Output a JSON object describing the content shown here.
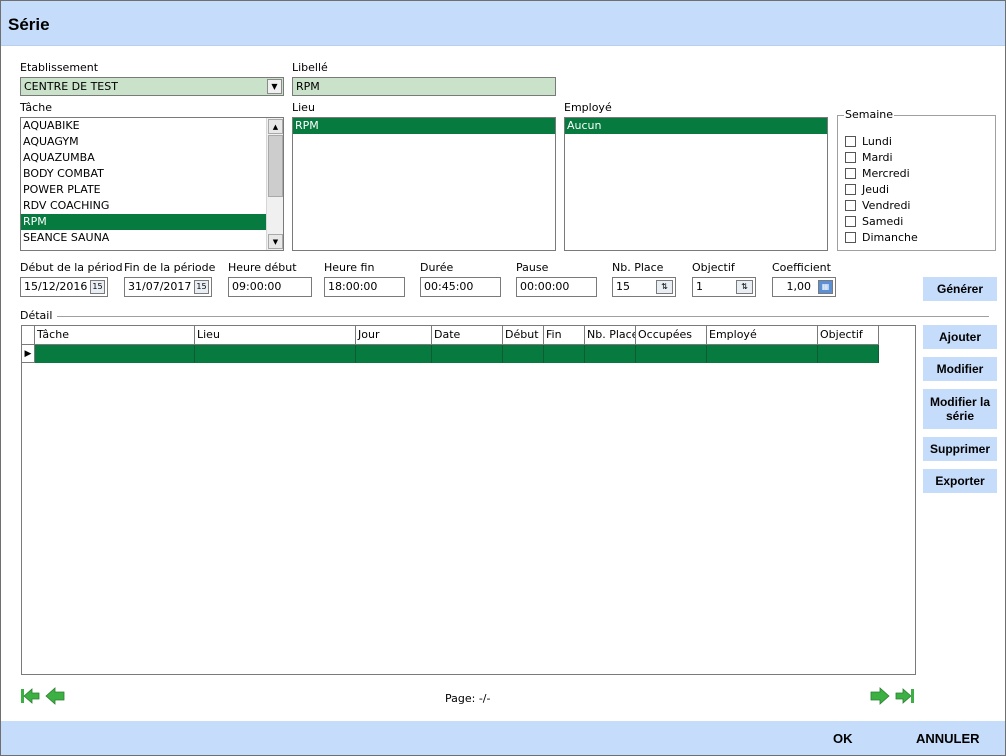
{
  "window": {
    "title": "Série"
  },
  "etablissement": {
    "label": "Etablissement",
    "value": "CENTRE DE TEST"
  },
  "libelle": {
    "label": "Libellé",
    "value": "RPM"
  },
  "tache": {
    "label": "Tâche",
    "items": [
      "AQUABIKE",
      "AQUAGYM",
      "AQUAZUMBA",
      "BODY COMBAT",
      "POWER PLATE",
      "RDV COACHING",
      "RPM",
      "SEANCE SAUNA"
    ],
    "selected": "RPM"
  },
  "lieu": {
    "label": "Lieu",
    "items": [
      "RPM"
    ],
    "selected": "RPM"
  },
  "employe": {
    "label": "Employé",
    "items": [
      "Aucun"
    ],
    "selected": "Aucun"
  },
  "semaine": {
    "label": "Semaine",
    "days": [
      "Lundi",
      "Mardi",
      "Mercredi",
      "Jeudi",
      "Vendredi",
      "Samedi",
      "Dimanche"
    ]
  },
  "params": {
    "debut_label": "Début de la périod",
    "debut_value": "15/12/2016",
    "fin_label": "Fin de la période",
    "fin_value": "31/07/2017",
    "heure_debut_label": "Heure début",
    "heure_debut_value": "09:00:00",
    "heure_fin_label": "Heure fin",
    "heure_fin_value": "18:00:00",
    "duree_label": "Durée",
    "duree_value": "00:45:00",
    "pause_label": "Pause",
    "pause_value": "00:00:00",
    "nbplace_label": "Nb. Place",
    "nbplace_value": "15",
    "objectif_label": "Objectif",
    "objectif_value": "1",
    "coef_label": "Coefficient",
    "coef_value": "1,00"
  },
  "detail": {
    "label": "Détail",
    "columns": [
      "Tâche",
      "Lieu",
      "Jour",
      "Date",
      "Début",
      "Fin",
      "Nb. Place",
      "Occupées",
      "Employé",
      "Objectif"
    ]
  },
  "buttons": {
    "generer": "Générer",
    "ajouter": "Ajouter",
    "modifier": "Modifier",
    "modifier_serie": "Modifier la série",
    "supprimer": "Supprimer",
    "exporter": "Exporter",
    "ok": "OK",
    "annuler": "ANNULER"
  },
  "pager": {
    "text": "Page: -/-"
  },
  "colors": {
    "accent": "#c5dcfa",
    "selection": "#067a3f",
    "nav_arrow": "#3cb043"
  }
}
